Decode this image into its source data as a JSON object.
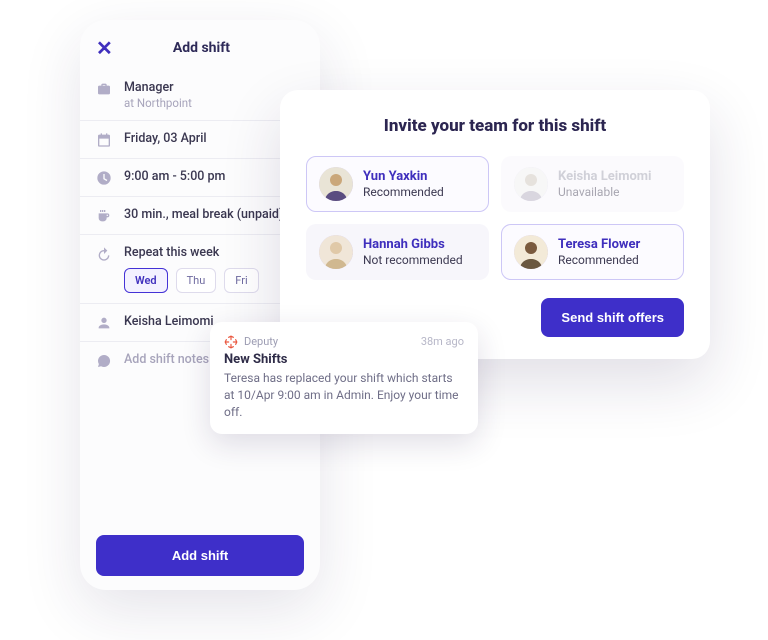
{
  "phone": {
    "title": "Add shift",
    "role": "Manager",
    "location_prefix": "at",
    "location": "Northpoint",
    "date": "Friday, 03 April",
    "time": "9:00 am - 5:00 pm",
    "break": "30 min., meal break (unpaid)",
    "repeat_label": "Repeat this week",
    "days": [
      {
        "label": "Wed",
        "selected": true
      },
      {
        "label": "Thu",
        "selected": false
      },
      {
        "label": "Fri",
        "selected": false
      }
    ],
    "assignee": "Keisha Leimomi",
    "notes_placeholder": "Add shift notes",
    "submit": "Add shift"
  },
  "panel": {
    "title": "Invite your team for this shift",
    "members": [
      {
        "name": "Yun Yaxkin",
        "status": "Recommended",
        "selected": true,
        "disabled": false
      },
      {
        "name": "Keisha Leimomi",
        "status": "Unavailable",
        "selected": false,
        "disabled": true
      },
      {
        "name": "Hannah Gibbs",
        "status": "Not recommended",
        "selected": false,
        "disabled": false
      },
      {
        "name": "Teresa Flower",
        "status": "Recommended",
        "selected": true,
        "disabled": false
      }
    ],
    "cta": "Send shift offers"
  },
  "notif": {
    "app": "Deputy",
    "time": "38m ago",
    "title": "New Shifts",
    "body": "Teresa has replaced your shift which starts at 10/Apr 9:00 am in Admin. Enjoy your time off."
  }
}
